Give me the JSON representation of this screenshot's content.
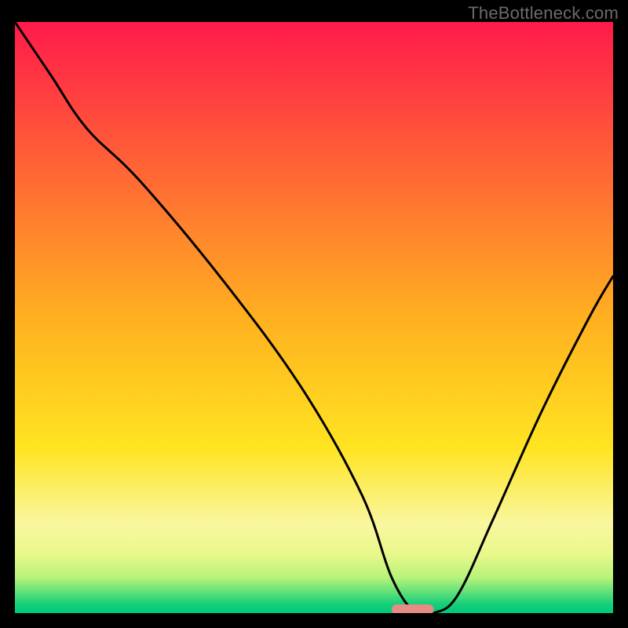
{
  "watermark": "TheBottleneck.com",
  "chart_data": {
    "type": "line",
    "title": "",
    "xlabel": "",
    "ylabel": "",
    "xlim": [
      0,
      100
    ],
    "ylim": [
      0,
      100
    ],
    "x": [
      0,
      6,
      12,
      21,
      35,
      48,
      58,
      63,
      67,
      70,
      74,
      80,
      88,
      96,
      100
    ],
    "values": [
      100,
      91,
      82,
      73,
      56,
      38,
      20,
      6,
      0,
      0,
      3,
      16,
      34,
      50,
      57
    ],
    "marker": {
      "x_range": [
        63,
        70
      ],
      "y": 0,
      "color": "#e98b85"
    },
    "gradient_stops": [
      {
        "offset": 0.0,
        "color": "#ff1a4a"
      },
      {
        "offset": 0.5,
        "color": "#ffb020"
      },
      {
        "offset": 0.72,
        "color": "#ffe421"
      },
      {
        "offset": 0.85,
        "color": "#f9f7a0"
      },
      {
        "offset": 0.9,
        "color": "#e9f88b"
      },
      {
        "offset": 0.94,
        "color": "#b6f37a"
      },
      {
        "offset": 0.965,
        "color": "#5fe079"
      },
      {
        "offset": 0.985,
        "color": "#16cf7a"
      },
      {
        "offset": 1.0,
        "color": "#00c97b"
      }
    ]
  }
}
